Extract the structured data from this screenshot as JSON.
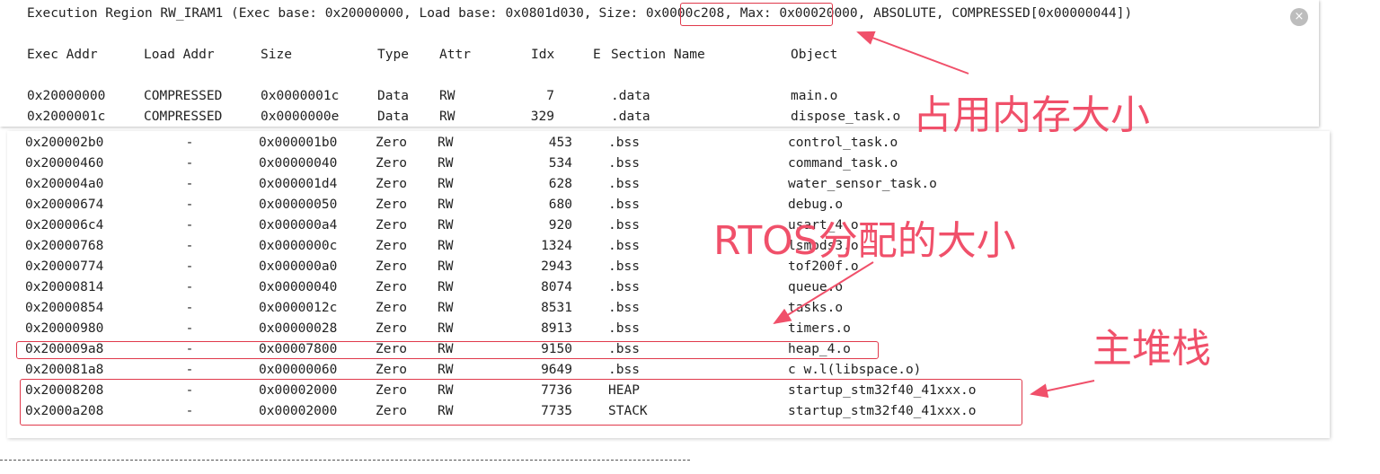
{
  "header": {
    "prefix": "Execution Region RW_IRAM1 (Exec base: 0x20000000, Load base: 0x0801d030,",
    "size_text": "Size: 0x0000c208",
    "suffix": ", Max: 0x00020000, ABSOLUTE, COMPRESSED[0x00000044])"
  },
  "columns": {
    "exec_addr": "Exec Addr",
    "load_addr": "Load Addr",
    "size": "Size",
    "type": "Type",
    "attr": "Attr",
    "idx": "Idx",
    "e": "E",
    "section_name": "Section Name",
    "object": "Object"
  },
  "top_rows": [
    {
      "exec": "0x20000000",
      "load": "COMPRESSED",
      "size": "0x0000001c",
      "type": "Data",
      "attr": "RW",
      "idx": "7",
      "section": ".data",
      "object": "main.o"
    },
    {
      "exec": "0x2000001c",
      "load": "COMPRESSED",
      "size": "0x0000000e",
      "type": "Data",
      "attr": "RW",
      "idx": "329",
      "section": ".data",
      "object": "dispose_task.o"
    }
  ],
  "rows": [
    {
      "exec": "0x200002b0",
      "load": "-",
      "size": "0x000001b0",
      "type": "Zero",
      "attr": "RW",
      "idx": "453",
      "section": ".bss",
      "object": "control_task.o"
    },
    {
      "exec": "0x20000460",
      "load": "-",
      "size": "0x00000040",
      "type": "Zero",
      "attr": "RW",
      "idx": "534",
      "section": ".bss",
      "object": "command_task.o"
    },
    {
      "exec": "0x200004a0",
      "load": "-",
      "size": "0x000001d4",
      "type": "Zero",
      "attr": "RW",
      "idx": "628",
      "section": ".bss",
      "object": "water_sensor_task.o"
    },
    {
      "exec": "0x20000674",
      "load": "-",
      "size": "0x00000050",
      "type": "Zero",
      "attr": "RW",
      "idx": "680",
      "section": ".bss",
      "object": "debug.o"
    },
    {
      "exec": "0x200006c4",
      "load": "-",
      "size": "0x000000a4",
      "type": "Zero",
      "attr": "RW",
      "idx": "920",
      "section": ".bss",
      "object": "usart_4.o"
    },
    {
      "exec": "0x20000768",
      "load": "-",
      "size": "0x0000000c",
      "type": "Zero",
      "attr": "RW",
      "idx": "1324",
      "section": ".bss",
      "object": "lsmods3.o"
    },
    {
      "exec": "0x20000774",
      "load": "-",
      "size": "0x000000a0",
      "type": "Zero",
      "attr": "RW",
      "idx": "2943",
      "section": ".bss",
      "object": "tof200f.o"
    },
    {
      "exec": "0x20000814",
      "load": "-",
      "size": "0x00000040",
      "type": "Zero",
      "attr": "RW",
      "idx": "8074",
      "section": ".bss",
      "object": "queue.o"
    },
    {
      "exec": "0x20000854",
      "load": "-",
      "size": "0x0000012c",
      "type": "Zero",
      "attr": "RW",
      "idx": "8531",
      "section": ".bss",
      "object": "tasks.o"
    },
    {
      "exec": "0x20000980",
      "load": "-",
      "size": "0x00000028",
      "type": "Zero",
      "attr": "RW",
      "idx": "8913",
      "section": ".bss",
      "object": "timers.o"
    },
    {
      "exec": "0x200009a8",
      "load": "-",
      "size": "0x00007800",
      "type": "Zero",
      "attr": "RW",
      "idx": "9150",
      "section": ".bss",
      "object": "heap_4.o"
    },
    {
      "exec": "0x200081a8",
      "load": "-",
      "size": "0x00000060",
      "type": "Zero",
      "attr": "RW",
      "idx": "9649",
      "section": ".bss",
      "object": "c w.l(libspace.o)"
    },
    {
      "exec": "0x20008208",
      "load": "-",
      "size": "0x00002000",
      "type": "Zero",
      "attr": "RW",
      "idx": "7736",
      "section": "HEAP",
      "object": "startup_stm32f40_41xxx.o"
    },
    {
      "exec": "0x2000a208",
      "load": "-",
      "size": "0x00002000",
      "type": "Zero",
      "attr": "RW",
      "idx": "7735",
      "section": "STACK",
      "object": "startup_stm32f40_41xxx.o"
    }
  ],
  "annotations": {
    "memory_usage": "占用内存大小",
    "rtos_alloc": "RTOS分配的大小",
    "main_stack": "主堆栈"
  },
  "close_icon": "×",
  "colors": {
    "annotation": "#f0506a",
    "box": "#e0394b"
  }
}
